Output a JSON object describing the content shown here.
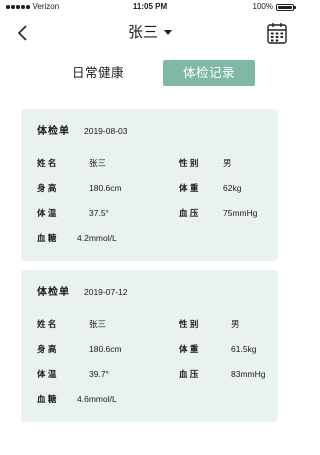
{
  "status": {
    "carrier": "Verizon",
    "time": "11:05 PM",
    "battery": "100%"
  },
  "nav": {
    "title": "张三"
  },
  "tabs": [
    {
      "label": "日常健康"
    },
    {
      "label": "体检记录"
    }
  ],
  "records": [
    {
      "heading": "体检单",
      "date": "2019-08-03",
      "fields": {
        "name": {
          "label": "姓 名",
          "value": "张三"
        },
        "gender": {
          "label": "性 别",
          "value": "男"
        },
        "height": {
          "label": "身 高",
          "value": "180.6cm"
        },
        "weight": {
          "label": "体 重",
          "value": "62kg"
        },
        "temperature": {
          "label": "体 温",
          "value": "37.5°"
        },
        "blood_pressure": {
          "label": "血 压",
          "value": "75mmHg"
        },
        "blood_sugar": {
          "label": "血 糖",
          "value": "4.2mmol/L"
        }
      }
    },
    {
      "heading": "体检单",
      "date": "2019-07-12",
      "fields": {
        "name": {
          "label": "姓 名",
          "value": "张三"
        },
        "gender": {
          "label": "性 别",
          "value": "男"
        },
        "height": {
          "label": "身 高",
          "value": "180.6cm"
        },
        "weight": {
          "label": "体 重",
          "value": "61.5kg"
        },
        "temperature": {
          "label": "体 温",
          "value": "39.7°"
        },
        "blood_pressure": {
          "label": "血 压",
          "value": "83mmHg"
        },
        "blood_sugar": {
          "label": "血 糖",
          "value": "4.6mmol/L"
        }
      }
    }
  ],
  "colors": {
    "accent": "#7fb8a4",
    "card_bg": "#e9f2f0"
  }
}
